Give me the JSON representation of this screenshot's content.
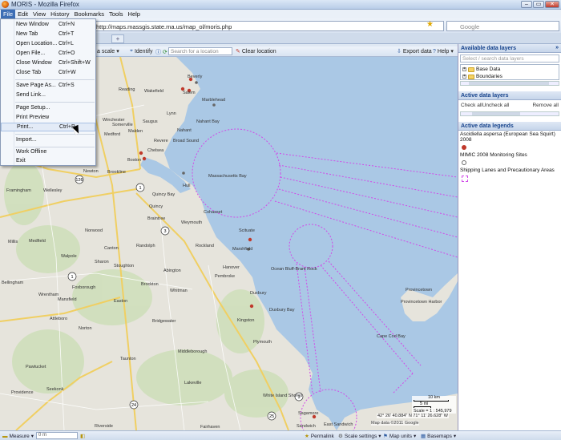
{
  "window": {
    "title": "MORIS - Mozilla Firefox",
    "minimize": "–",
    "maximize": "▭",
    "close": "✕"
  },
  "menubar": [
    "File",
    "Edit",
    "View",
    "History",
    "Bookmarks",
    "Tools",
    "Help"
  ],
  "address_bar": {
    "url": "http://maps.massgis.state.ma.us/map_ol/moris.php"
  },
  "search_bar": {
    "placeholder": "Google"
  },
  "tabs": {
    "new_tab": "+"
  },
  "file_menu": [
    {
      "label": "New Window",
      "shortcut": "Ctrl+N"
    },
    {
      "label": "New Tab",
      "shortcut": "Ctrl+T"
    },
    {
      "label": "Open Location...",
      "shortcut": "Ctrl+L"
    },
    {
      "label": "Open File...",
      "shortcut": "Ctrl+O"
    },
    {
      "label": "Close Window",
      "shortcut": "Ctrl+Shift+W"
    },
    {
      "label": "Close Tab",
      "shortcut": "Ctrl+W"
    },
    {
      "label": "Save Page As...",
      "shortcut": "Ctrl+S"
    },
    {
      "label": "Send Link...",
      "shortcut": ""
    },
    {
      "label": "Page Setup...",
      "shortcut": ""
    },
    {
      "label": "Print Preview",
      "shortcut": ""
    },
    {
      "label": "Print...",
      "shortcut": "Ctrl+P"
    },
    {
      "label": "Import...",
      "shortcut": ""
    },
    {
      "label": "Work Offline",
      "shortcut": ""
    },
    {
      "label": "Exit",
      "shortcut": ""
    }
  ],
  "map_toolbar": {
    "scale_label": "a scale",
    "identify": "Identify",
    "search_placeholder": "Search for a location",
    "clear_location": "Clear location",
    "export_data": "Export data",
    "help": "Help"
  },
  "map": {
    "places": [
      "Beverly",
      "Reading",
      "Wakefield",
      "Salem",
      "Marblehead",
      "Lynn",
      "Winchester",
      "Saugus",
      "Malden",
      "Medford",
      "Revere",
      "Nahant Bay",
      "Somerville",
      "Chelsea",
      "Nahant",
      "Broad Sound",
      "Newton",
      "Brookline",
      "Boston",
      "Quincy Bay",
      "Massachusetts Bay",
      "Framingham",
      "Wellesley",
      "Hull",
      "Quincy",
      "Weymouth",
      "Braintree",
      "Norwood",
      "Cohasset",
      "Scituate",
      "Millis",
      "Medfield",
      "Canton",
      "Randolph",
      "Rockland",
      "Walpole",
      "Sharon",
      "Stoughton",
      "Abington",
      "Hanover",
      "Marshfield",
      "Brockton",
      "Ocean Bluff-Brant Rock",
      "Pembroke",
      "Bellingham",
      "Foxborough",
      "Wrentham",
      "Mansfield",
      "Whitman",
      "Duxbury",
      "Duxbury Bay",
      "Easton",
      "Bridgewater",
      "Kingston",
      "Plymouth",
      "Attleboro",
      "Norton",
      "Taunton",
      "Middleborough",
      "Pawtucket",
      "Providence",
      "Seekonk",
      "Lakeville",
      "Provincetown",
      "Provincetown Harbor",
      "Cape Cod Bay",
      "White Island Shores",
      "Sagamore",
      "East Sandwich",
      "Sandwich",
      "Riverside",
      "Fairhaven"
    ],
    "coordinates": "42° 26' 40.884\" N 71° 11' 26.628\" W",
    "attribution": "Map data ©2011 Google",
    "scale": {
      "km": "10 km",
      "mi": "5 mi",
      "ratio": "Scale = 1 : 545,979"
    }
  },
  "statusbar": {
    "measure": "Measure",
    "measure_value": "0 m",
    "permalink": "Permalink",
    "scale_settings": "Scale settings",
    "map_units": "Map units",
    "basemaps": "Basemaps"
  },
  "side_panel": {
    "available_title": "Available data layers",
    "collapse": "»",
    "search_placeholder": "Select / search data layers",
    "tree": [
      "Base Data",
      "Boundaries"
    ],
    "active_title": "Active data layers",
    "check_all": "Check all",
    "uncheck_all": "Uncheck all",
    "remove_all": "Remove all",
    "legends_title": "Active data legends",
    "legends": [
      {
        "label": "Ascidiella aspersa (European Sea Squirt) 2008",
        "swatch": "dot",
        "color": "#c0392b"
      },
      {
        "label": "MIMIC 2008 Monitoring Sites",
        "swatch": "dot",
        "color": "#666666"
      },
      {
        "label": "Shipping Lanes and Precautionary Areas",
        "swatch": "box",
        "color": "#d14ae8"
      }
    ]
  },
  "colors": {
    "lane": "#d14ae8",
    "water": "#a9c8e6",
    "land": "#e8e6df",
    "forest": "#c9dcb0",
    "highway": "#f3d36b"
  }
}
